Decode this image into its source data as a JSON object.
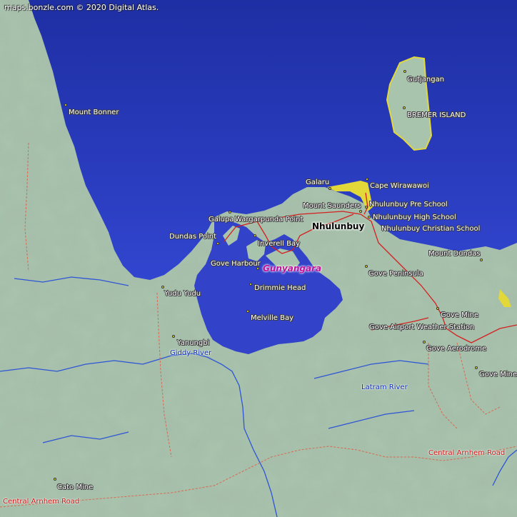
{
  "copyright": "maps.bonzle.com © 2020 Digital Atlas.",
  "colors": {
    "sea": "#2a3fc7",
    "deep_sea": "#1f2fa8",
    "land": "#a9c4ad",
    "river": "#2e55d6",
    "road": "#d42020",
    "track": "#d86a50",
    "coast_sand": "#e3d83a"
  },
  "places": {
    "gutjangan": "Gutjangan",
    "bremer_island": "BREMER ISLAND",
    "mount_bonner": "Mount Bonner",
    "galaru": "Galaru",
    "cape_wirawawoi": "Cape Wirawawoi",
    "nhulunbuy_pre_school": "Nhulunbuy Pre School",
    "mount_saunders": "Mount Saunders",
    "nhulunbuy_high_school": "Nhulunbuy High School",
    "galupa": "Galupa",
    "wargarpunda_point": "Wargarpunda Point",
    "nhulunbuy": "Nhulunbuy",
    "nhulunbuy_christian_school": "Nhulunbuy Christian School",
    "dundas_point": "Dundas Point",
    "inverell_bay": "Inverell Bay",
    "mount_dundas": "Mount Dundas",
    "gove_harbour": "Gove Harbour",
    "gunyangara": "Gunyangara",
    "gove_peninsula": "Gove Peninsula",
    "yudu_yudu": "Yudu Yudu",
    "drimmie_head": "Drimmie Head",
    "gove_mine_1": "Gove Mine",
    "melville_bay": "Melville Bay",
    "gove_airport_weather_station": "Gove Airport Weather Station",
    "yanungbi": "Yanungbi",
    "giddy_river": "Giddy River",
    "gove_aerodrome": "Gove Aerodrome",
    "gove_mine_2": "Gove Mine",
    "latram_river": "Latram River",
    "central_arnhem_road_1": "Central Arnhem Road",
    "cato_mine": "Cato Mine",
    "central_arnhem_road_2": "Central Arnhem Road"
  }
}
